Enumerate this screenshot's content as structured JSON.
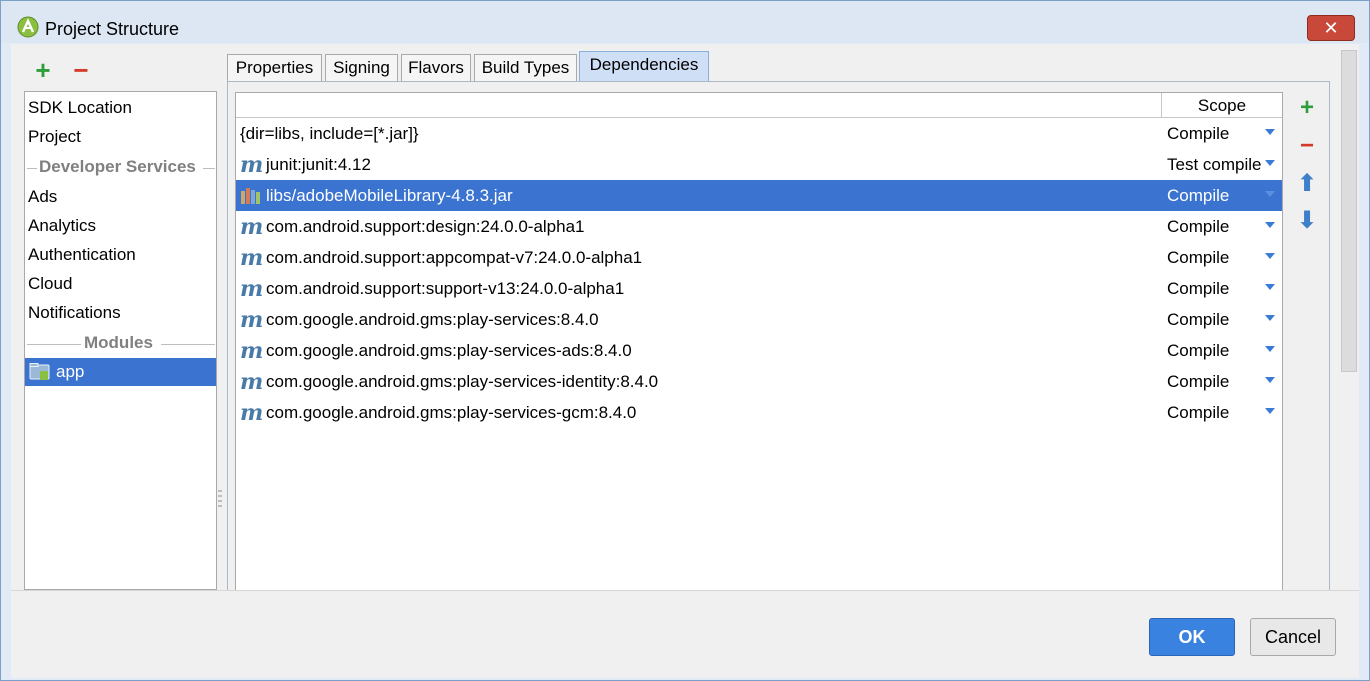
{
  "window": {
    "title": "Project Structure",
    "close_glyph": "✕"
  },
  "toolbar": {
    "add_glyph": "+",
    "remove_glyph": "−"
  },
  "sidebar": {
    "items": [
      {
        "label": "SDK Location"
      },
      {
        "label": "Project"
      }
    ],
    "group_developer_services": "Developer Services",
    "services": [
      {
        "label": "Ads"
      },
      {
        "label": "Analytics"
      },
      {
        "label": "Authentication"
      },
      {
        "label": "Cloud"
      },
      {
        "label": "Notifications"
      }
    ],
    "group_modules": "Modules",
    "modules": [
      {
        "label": "app",
        "selected": true
      }
    ]
  },
  "tabs": [
    {
      "label": "Properties"
    },
    {
      "label": "Signing"
    },
    {
      "label": "Flavors"
    },
    {
      "label": "Build Types"
    },
    {
      "label": "Dependencies",
      "active": true
    }
  ],
  "table": {
    "scope_header": "Scope",
    "rows": [
      {
        "name": "{dir=libs, include=[*.jar]}",
        "scope": "Compile",
        "icon": "none"
      },
      {
        "name": "junit:junit:4.12",
        "scope": "Test compile",
        "icon": "maven-icon"
      },
      {
        "name": "libs/adobeMobileLibrary-4.8.3.jar",
        "scope": "Compile",
        "icon": "jar-library-icon",
        "selected": true
      },
      {
        "name": "com.android.support:design:24.0.0-alpha1",
        "scope": "Compile",
        "icon": "maven-icon"
      },
      {
        "name": "com.android.support:appcompat-v7:24.0.0-alpha1",
        "scope": "Compile",
        "icon": "maven-icon"
      },
      {
        "name": "com.android.support:support-v13:24.0.0-alpha1",
        "scope": "Compile",
        "icon": "maven-icon"
      },
      {
        "name": "com.google.android.gms:play-services:8.4.0",
        "scope": "Compile",
        "icon": "maven-icon"
      },
      {
        "name": "com.google.android.gms:play-services-ads:8.4.0",
        "scope": "Compile",
        "icon": "maven-icon"
      },
      {
        "name": "com.google.android.gms:play-services-identity:8.4.0",
        "scope": "Compile",
        "icon": "maven-icon"
      },
      {
        "name": "com.google.android.gms:play-services-gcm:8.4.0",
        "scope": "Compile",
        "icon": "maven-icon"
      }
    ]
  },
  "side_tools": {
    "add": "+",
    "remove": "−",
    "up": "⬆",
    "down": "⬇"
  },
  "footer": {
    "ok_label": "OK",
    "cancel_label": "Cancel"
  },
  "colors": {
    "selection": "#3a73d0",
    "add": "#2e9d3a",
    "remove": "#d23a2a",
    "ok_button": "#3a82e0"
  }
}
